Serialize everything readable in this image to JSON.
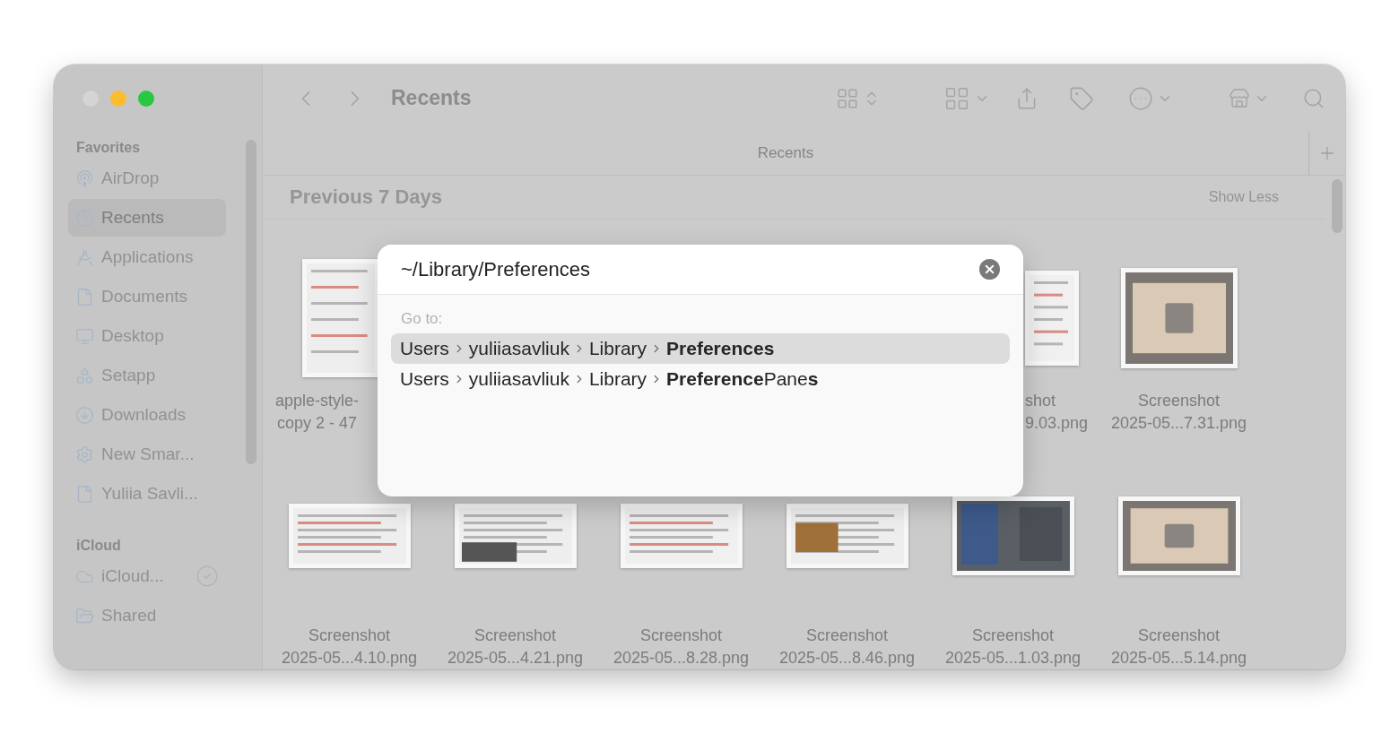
{
  "window": {
    "title": "Recents"
  },
  "sidebar": {
    "sections": [
      {
        "title": "Favorites",
        "items": [
          {
            "label": "AirDrop",
            "selected": false
          },
          {
            "label": "Recents",
            "selected": true
          },
          {
            "label": "Applications",
            "selected": false
          },
          {
            "label": "Documents",
            "selected": false
          },
          {
            "label": "Desktop",
            "selected": false
          },
          {
            "label": "Setapp",
            "selected": false
          },
          {
            "label": "Downloads",
            "selected": false
          },
          {
            "label": "New Smar...",
            "selected": false
          },
          {
            "label": "Yuliia Savli...",
            "selected": false
          }
        ]
      },
      {
        "title": "iCloud",
        "items": [
          {
            "label": "iCloud...",
            "selected": false,
            "synced": true
          },
          {
            "label": "Shared",
            "selected": false
          }
        ]
      }
    ]
  },
  "tab_bar": {
    "tabs": [
      {
        "label": "Recents",
        "selected": true
      }
    ]
  },
  "section": {
    "title": "Previous 7 Days",
    "action": "Show Less"
  },
  "files": {
    "rows": [
      {
        "items": [
          {
            "name_lines": [
              "apple-style-",
              "copy 2 - 47"
            ]
          },
          {
            "name_lines": [
              "shot",
              "9.03.png"
            ]
          },
          {
            "name_lines": [
              "Screenshot",
              "2025-05...7.31.png"
            ]
          }
        ]
      },
      {
        "items": [
          {
            "name_lines": [
              "Screenshot",
              "2025-05...4.10.png"
            ]
          },
          {
            "name_lines": [
              "Screenshot",
              "2025-05...4.21.png"
            ]
          },
          {
            "name_lines": [
              "Screenshot",
              "2025-05...8.28.png"
            ]
          },
          {
            "name_lines": [
              "Screenshot",
              "2025-05...8.46.png"
            ]
          },
          {
            "name_lines": [
              "Screenshot",
              "2025-05...1.03.png"
            ]
          },
          {
            "name_lines": [
              "Screenshot",
              "2025-05...5.14.png"
            ]
          }
        ]
      }
    ]
  },
  "goto_dialog": {
    "value": "~/Library/Preferences",
    "heading": "Go to:",
    "suggestions": [
      {
        "segments": [
          "Users",
          "yuliiasavliuk",
          "Library",
          "**Preferences**"
        ],
        "selected": true
      },
      {
        "segments": [
          "Users",
          "yuliiasavliuk",
          "Library",
          "**Preference**Pane**s**"
        ],
        "selected": false
      }
    ]
  }
}
